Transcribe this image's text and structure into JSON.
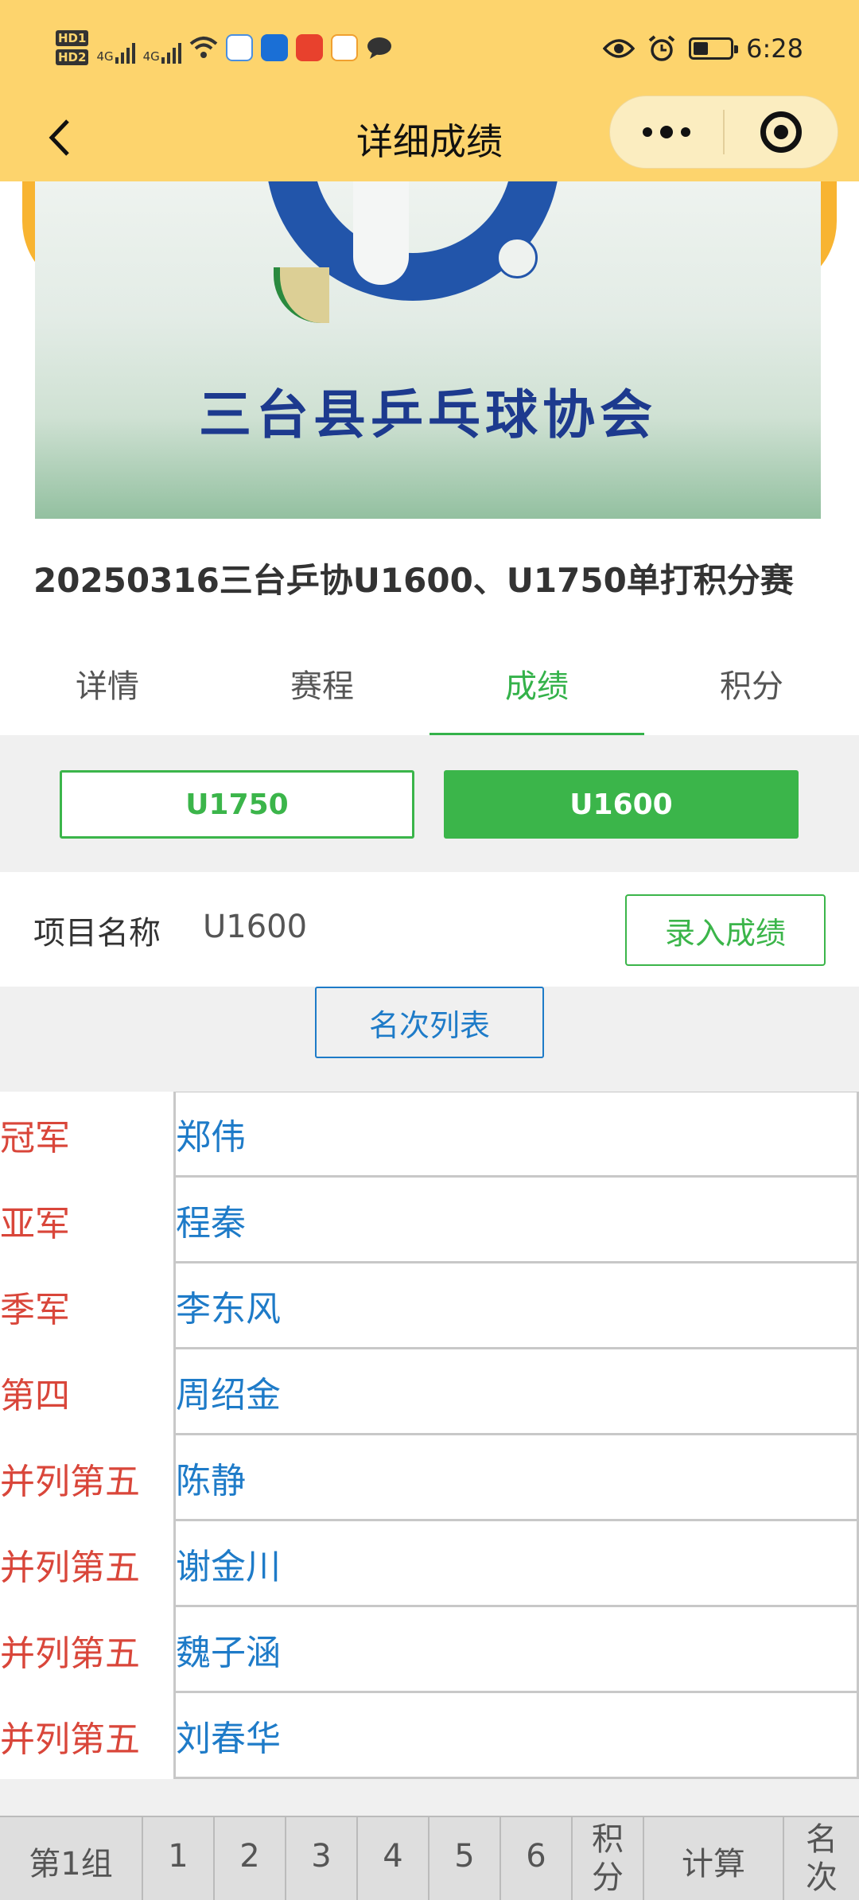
{
  "status_bar": {
    "hd1": "HD1",
    "hd2": "HD2",
    "net1": "4G",
    "net2": "4G",
    "time": "6:28"
  },
  "nav": {
    "title": "详细成绩"
  },
  "banner": {
    "org_name": "三台县乒乓球协会"
  },
  "event": {
    "title": "20250316三台乒协U1600、U1750单打积分赛"
  },
  "tabs": [
    {
      "label": "详情"
    },
    {
      "label": "赛程"
    },
    {
      "label": "成绩"
    },
    {
      "label": "积分"
    }
  ],
  "active_tab": "成绩",
  "categories": [
    {
      "label": "U1750",
      "selected": false
    },
    {
      "label": "U1600",
      "selected": true
    }
  ],
  "project": {
    "label": "项目名称",
    "value": "U1600",
    "enter_button": "录入成绩"
  },
  "rank_list": {
    "button": "名次列表",
    "rows": [
      {
        "place": "冠军",
        "name": "郑伟"
      },
      {
        "place": "亚军",
        "name": "程秦"
      },
      {
        "place": "季军",
        "name": "李东风"
      },
      {
        "place": "第四",
        "name": "周绍金"
      },
      {
        "place": "并列第五",
        "name": "陈静"
      },
      {
        "place": "并列第五",
        "name": "谢金川"
      },
      {
        "place": "并列第五",
        "name": "魏子涵"
      },
      {
        "place": "并列第五",
        "name": "刘春华"
      }
    ]
  },
  "group_table": {
    "group": "第1组",
    "cols": [
      "1",
      "2",
      "3",
      "4",
      "5",
      "6"
    ],
    "points_top": "积",
    "points_bottom": "分",
    "calc": "计算",
    "rank_top": "名",
    "rank_bottom": "次"
  },
  "colors": {
    "header_bg": "#fdd46d",
    "accent_green": "#3bb54a",
    "link_blue": "#1e7bc8",
    "place_red": "#d9463a"
  }
}
